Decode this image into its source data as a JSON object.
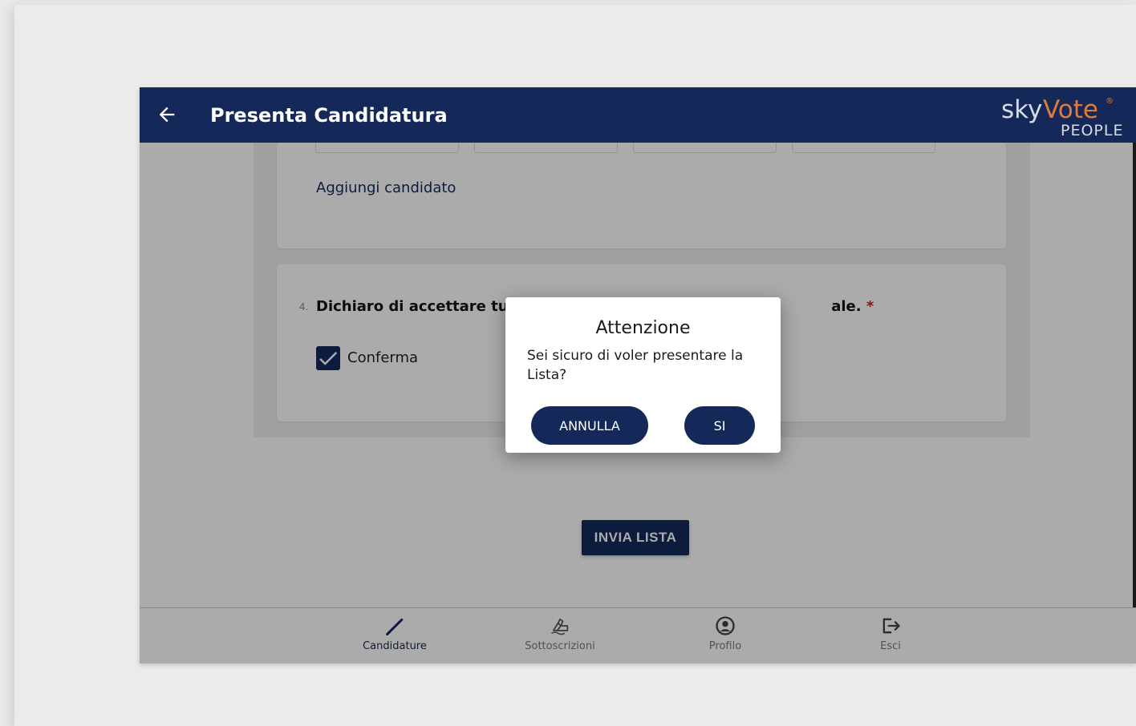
{
  "header": {
    "title": "Presenta Candidatura",
    "logo": {
      "sky": "sky",
      "vote": "Vote",
      "reg": "®",
      "people": "PEOPLE"
    }
  },
  "form": {
    "add_candidate_link": "Aggiungi candidato",
    "question": {
      "number": "4.",
      "text": "Dichiaro di accettare tutte le",
      "text_tail": "ale.",
      "required_mark": "*"
    },
    "checkbox": {
      "label": "Conferma",
      "checked": true
    }
  },
  "actions": {
    "send_list": "INVIA LISTA"
  },
  "dialog": {
    "title": "Attenzione",
    "message": "Sei sicuro di voler presentare la Lista?",
    "cancel_label": "ANNULLA",
    "confirm_label": "SI"
  },
  "bottom_nav": {
    "items": [
      {
        "label": "Candidature",
        "icon": "pencil-icon",
        "active": true
      },
      {
        "label": "Sottoscrizioni",
        "icon": "signature-icon",
        "active": false
      },
      {
        "label": "Profilo",
        "icon": "profile-icon",
        "active": false
      },
      {
        "label": "Esci",
        "icon": "logout-icon",
        "active": false
      }
    ]
  },
  "colors": {
    "primary": "#14295a",
    "accent": "#e07a36",
    "required": "#c0262a"
  }
}
